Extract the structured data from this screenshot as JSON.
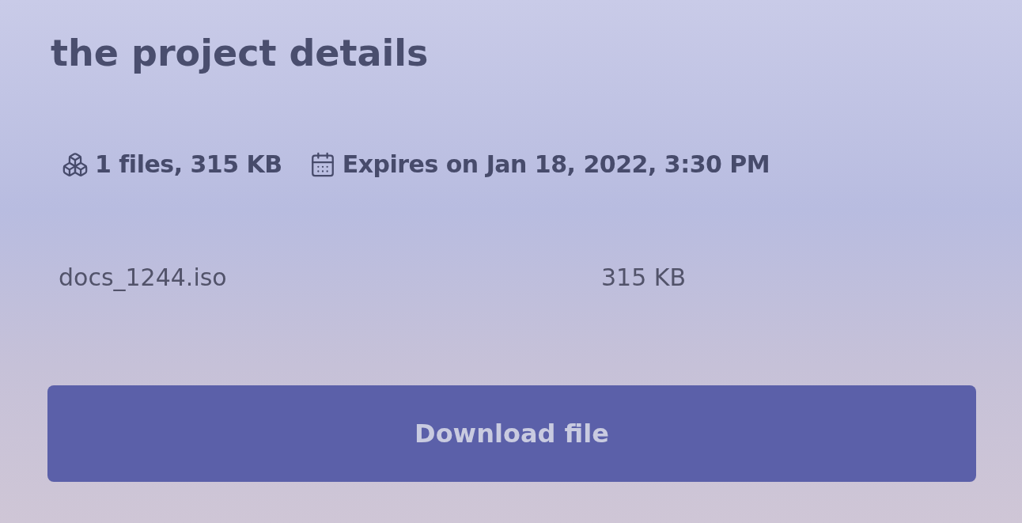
{
  "title": "the project details",
  "meta": [
    {
      "kind": "files",
      "text": "1 files, 315 KB"
    },
    {
      "kind": "expiry",
      "text": "Expires on Jan 18, 2022, 3:30 PM"
    }
  ],
  "files": [
    {
      "name": "docs_1244.iso",
      "size": "315 KB"
    }
  ],
  "button": {
    "label": "Download file"
  }
}
